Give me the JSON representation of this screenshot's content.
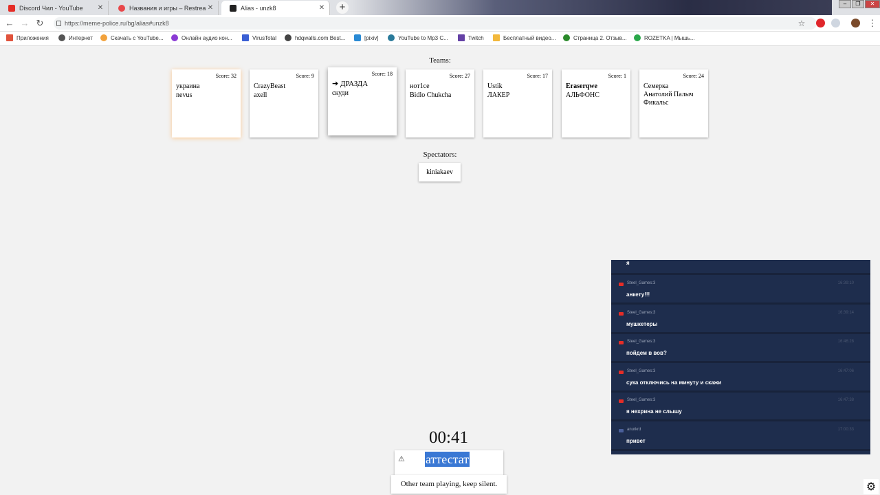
{
  "browser": {
    "tabs": [
      {
        "title": "Discord Чил - YouTube",
        "favicon_color": "#e52d27"
      },
      {
        "title": "Названия и игры – Restream",
        "favicon_color": "#e8474a"
      },
      {
        "title": "Alias - unzk8",
        "favicon_color": "#222222",
        "active": true
      }
    ],
    "new_tab": "+",
    "url": "https://meme-police.ru/bg/alias#unzk8",
    "bookmarks": [
      {
        "label": "Приложения",
        "color": "#e0533c"
      },
      {
        "label": "Интернет",
        "color": "#555555"
      },
      {
        "label": "Скачать с YouTube...",
        "color": "#f2a23c"
      },
      {
        "label": "Онлайн аудио кон...",
        "color": "#8a3ad4"
      },
      {
        "label": "VirusTotal",
        "color": "#3a5fd4"
      },
      {
        "label": "hdqwalls.com Best...",
        "color": "#444444"
      },
      {
        "label": "[pixiv]",
        "color": "#2a8ad4"
      },
      {
        "label": "YouTube to Mp3 C...",
        "color": "#2a7a9a"
      },
      {
        "label": "Twitch",
        "color": "#6441a5"
      },
      {
        "label": "Бесплатный видео...",
        "color": "#f2b83c"
      },
      {
        "label": "Страница 2. Отзыв...",
        "color": "#2a8a2a"
      },
      {
        "label": "ROZETKA | Мышь...",
        "color": "#2aa84a"
      }
    ]
  },
  "teams_label": "Teams:",
  "teams": [
    {
      "score": "Score: 32",
      "players": [
        "украина",
        "nevus"
      ]
    },
    {
      "score": "Score: 9",
      "players": [
        "CrazyBeast",
        "axell"
      ]
    },
    {
      "score": "Score: 18",
      "players": [
        "➔ ДРАЗДА",
        "скуди"
      ]
    },
    {
      "score": "Score: 27",
      "players": [
        "нот1се",
        "Bidlo Chukcha"
      ]
    },
    {
      "score": "Score: 17",
      "players": [
        "Ustik",
        "ЛАКЕР"
      ]
    },
    {
      "score": "Score: 1",
      "players": [
        "Eraserqwe",
        "АЛЬФОНС"
      ]
    },
    {
      "score": "Score: 24",
      "players": [
        "Семерка",
        "Анатолий Палыч",
        "Фикальс"
      ]
    }
  ],
  "spectators_label": "Spectators:",
  "spectators": [
    "kiniakaev"
  ],
  "timer": "00:41",
  "word": "аттестат",
  "warning_icon": "⚠",
  "status": "Other team playing, keep silent.",
  "chat": {
    "partial_text": "я",
    "messages": [
      {
        "user": "Steel_Games:3",
        "time": "16:39:10",
        "text": "анкету!!!"
      },
      {
        "user": "Steel_Games:3",
        "time": "16:39:14",
        "text": "мушкетеры"
      },
      {
        "user": "Steel_Games:3",
        "time": "16:46:28",
        "text": "пойдем в вов?"
      },
      {
        "user": "Steel_Games:3",
        "time": "16:47:06",
        "text": "сука отключись на минуту и скажи"
      },
      {
        "user": "Steel_Games:3",
        "time": "16:47:38",
        "text": "я нехрина не слышу"
      },
      {
        "user": "anurkrd",
        "time": "17:00:33",
        "text": "привет"
      }
    ]
  }
}
